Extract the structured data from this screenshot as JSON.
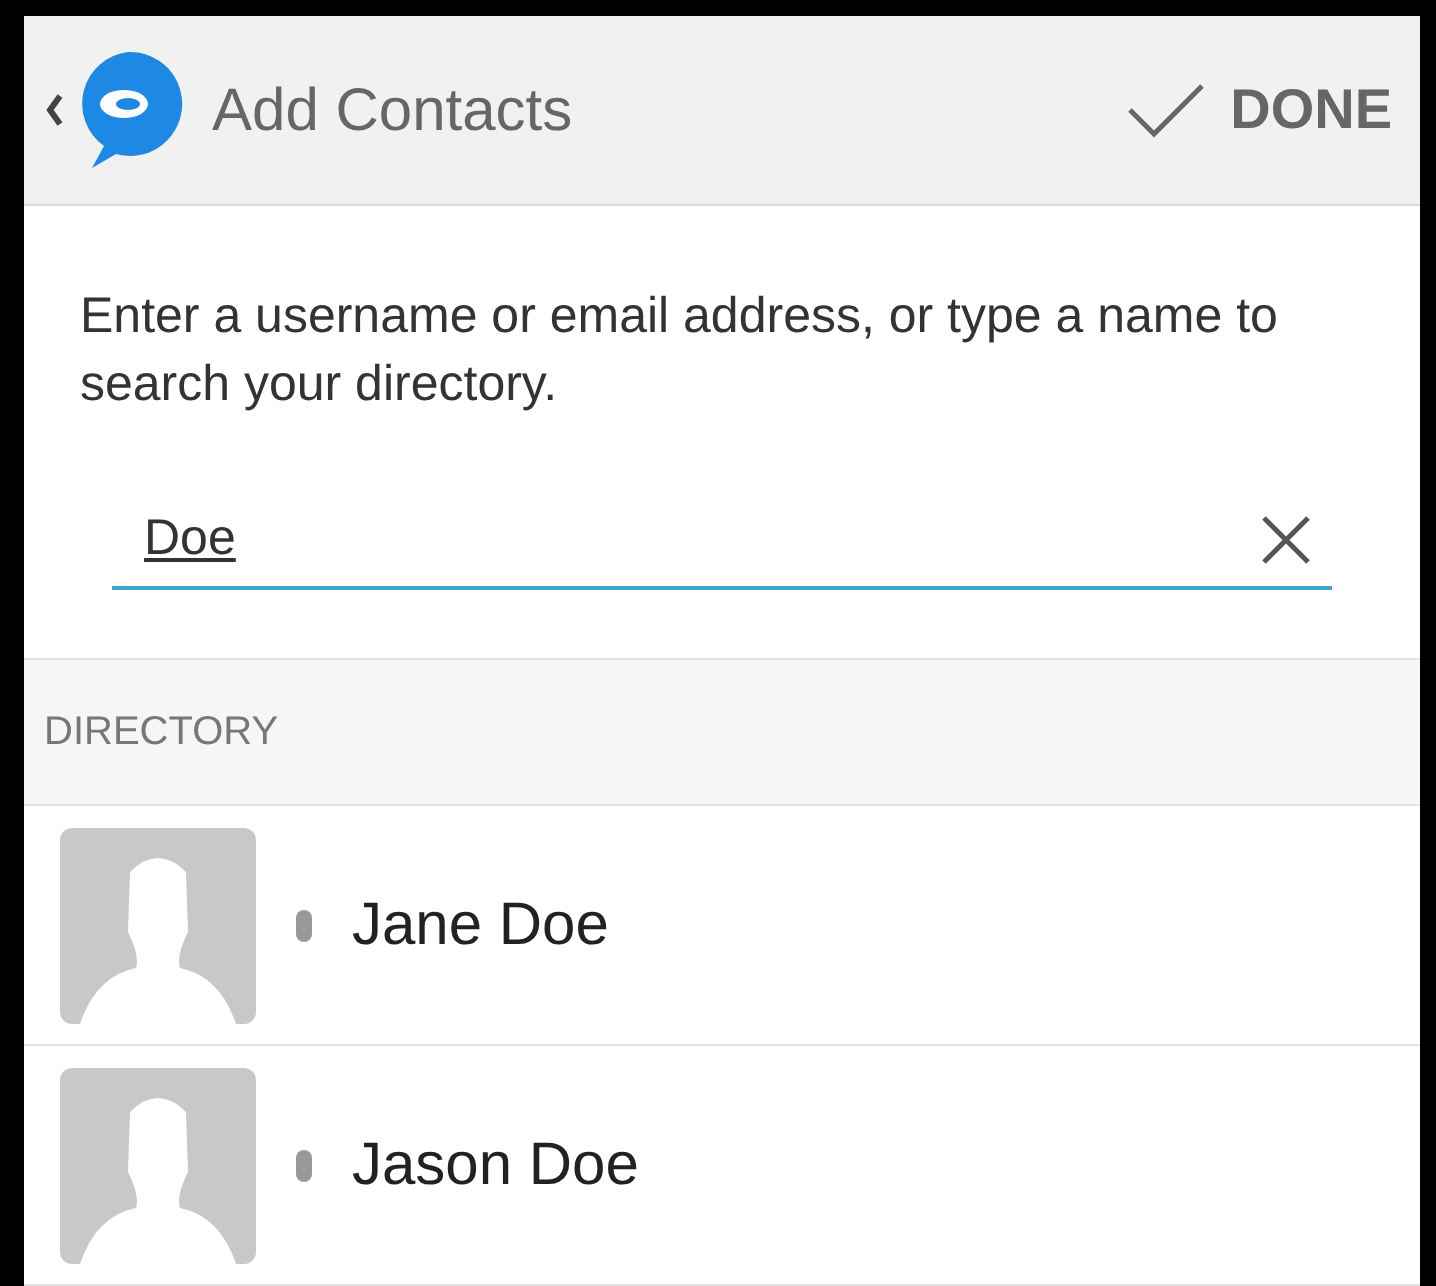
{
  "header": {
    "title": "Add Contacts",
    "done_label": "DONE"
  },
  "instructions": "Enter a username or email address, or type a name to search your directory.",
  "search": {
    "value": "Doe"
  },
  "section_label": "DIRECTORY",
  "contacts": [
    {
      "name": "Jane Doe"
    },
    {
      "name": "Jason Doe"
    }
  ]
}
